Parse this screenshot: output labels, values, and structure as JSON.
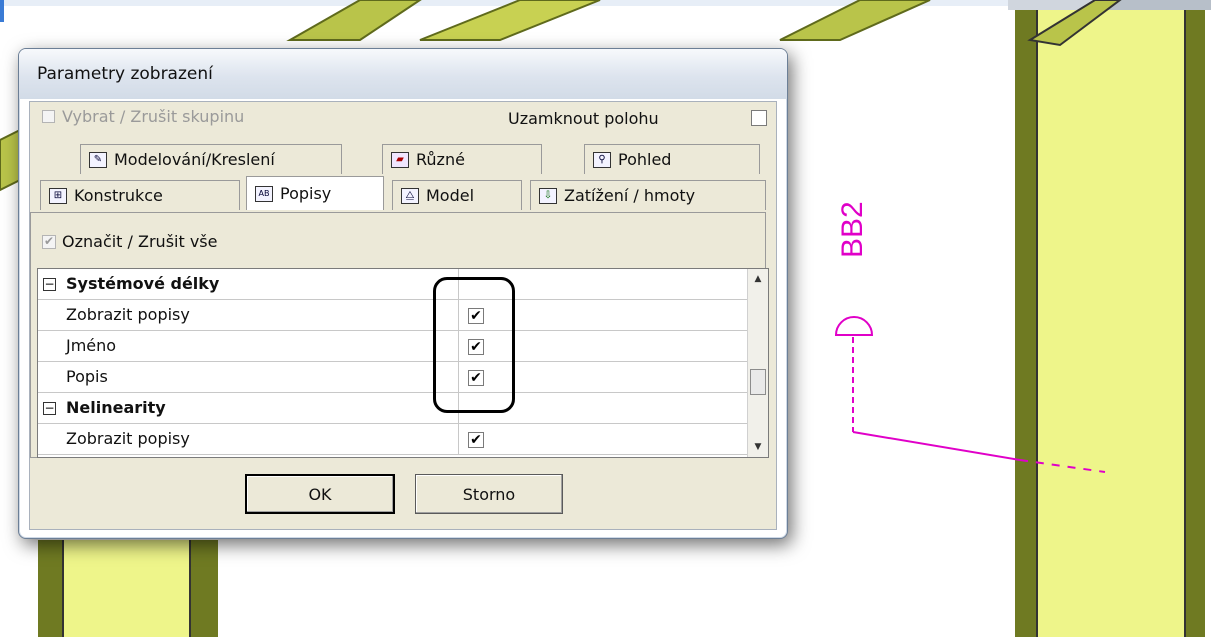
{
  "dialog": {
    "title": "Parametry zobrazení",
    "select_group": {
      "label": "Vybrat / Zrušit skupinu",
      "checked": false,
      "enabled": false
    },
    "lock_position": {
      "label": "Uzamknout polohu",
      "checked": false
    },
    "tabs_row1": [
      {
        "label": "Modelování/Kreslení",
        "icon": "drawing-icon"
      },
      {
        "label": "Různé",
        "icon": "misc-icon"
      },
      {
        "label": "Pohled",
        "icon": "view-icon"
      }
    ],
    "tabs_row2": [
      {
        "label": "Konstrukce",
        "icon": "structure-icon"
      },
      {
        "label": "Popisy",
        "icon": "labels-icon",
        "active": true
      },
      {
        "label": "Model",
        "icon": "model-icon"
      },
      {
        "label": "Zatížení / hmoty",
        "icon": "load-icon"
      }
    ],
    "mark_all": {
      "label": "Označit / Zrušit vše",
      "checked": true,
      "enabled": false
    },
    "rows": [
      {
        "name": "Systémové délky",
        "type": "group",
        "expander": "−"
      },
      {
        "name": "Zobrazit popisy",
        "type": "item",
        "checked": true
      },
      {
        "name": "Jméno",
        "type": "item",
        "checked": true
      },
      {
        "name": "Popis",
        "type": "item",
        "checked": true
      },
      {
        "name": "Nelinearity",
        "type": "group",
        "expander": "−"
      },
      {
        "name": "Zobrazit popisy",
        "type": "item",
        "checked": true
      }
    ],
    "ok_label": "OK",
    "cancel_label": "Storno",
    "check_glyph": "✔"
  },
  "scene": {
    "beam_label": "BB2",
    "beam_color": "#e9f07a",
    "beam_dark": "#6f7a22",
    "annotation_color": "#e000c8"
  }
}
